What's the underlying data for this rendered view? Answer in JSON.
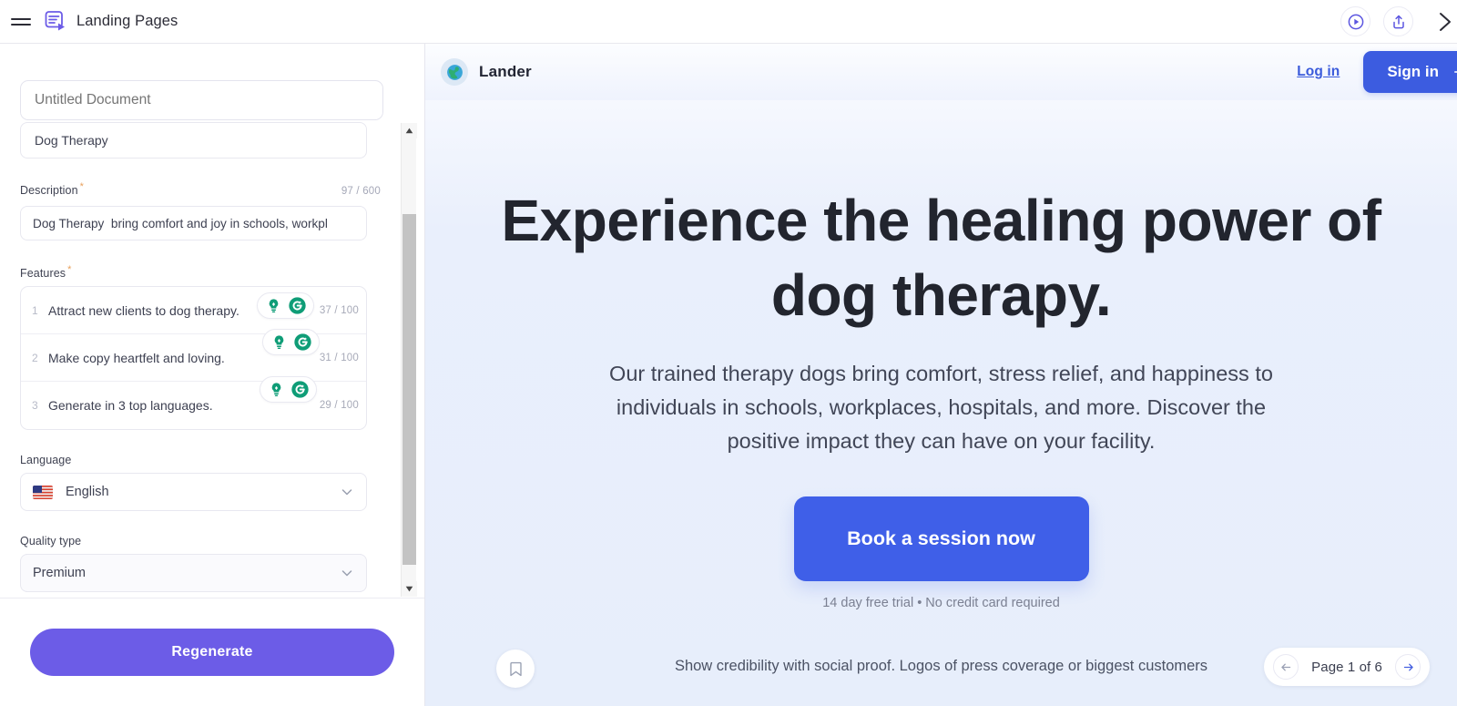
{
  "topbar": {
    "title": "Landing Pages",
    "menu_icon": "hamburger-menu-icon",
    "logo_icon": "landing-pages-logo-icon",
    "preview_icon": "play-circle-icon",
    "share_icon": "share-upload-icon",
    "collapse_icon": "chevron-right-icon"
  },
  "sidebar": {
    "title_field": {
      "placeholder": "Untitled Document",
      "value": ""
    },
    "subtitle_field": {
      "value": "Dog Therapy"
    },
    "description": {
      "label": "Description",
      "required": "*",
      "counter": "97 / 600",
      "value": "Dog Therapy  bring comfort and joy in schools, workpl"
    },
    "features": {
      "label": "Features",
      "required": "*",
      "items": [
        {
          "num": "1",
          "text": "Attract new clients to dog therapy.",
          "counter": "37 / 100"
        },
        {
          "num": "2",
          "text": "Make copy heartfelt and loving.",
          "counter": "31 / 100"
        },
        {
          "num": "3",
          "text": "Generate in 3 top languages.",
          "counter": "29 / 100"
        }
      ],
      "idea_icon": "lightbulb-icon",
      "regenerate_icon": "refresh-circle-icon"
    },
    "language": {
      "label": "Language",
      "value": "English",
      "flag": "us-flag-icon"
    },
    "quality": {
      "label": "Quality type",
      "value": "Premium"
    },
    "regenerate_button": "Regenerate"
  },
  "preview": {
    "nav": {
      "brand": "Lander",
      "brand_icon": "globe-icon",
      "login_label": "Log in",
      "signin_label": "Sign in",
      "signin_arrow": "arrow-right-icon"
    },
    "hero": {
      "headline": "Experience the healing power of dog therapy.",
      "subheadline": "Our trained therapy dogs bring comfort, stress relief, and happiness to individuals in schools, workplaces, hospitals, and more. Discover the positive impact they can have on your facility.",
      "cta_label": "Book a session now",
      "cta_note": "14 day free trial • No credit card required"
    },
    "footer": {
      "bookmark_icon": "bookmark-icon",
      "social_proof": "Show credibility with social proof. Logos of press coverage or biggest customers",
      "pager_label": "Page 1 of 6",
      "prev_icon": "arrow-left-circle-icon",
      "next_icon": "arrow-right-circle-icon"
    }
  },
  "colors": {
    "brand_purple": "#6c5ce7",
    "cta_blue": "#3f5fe8",
    "accent_green": "#0f9d77",
    "required_orange": "#e8a05c"
  }
}
